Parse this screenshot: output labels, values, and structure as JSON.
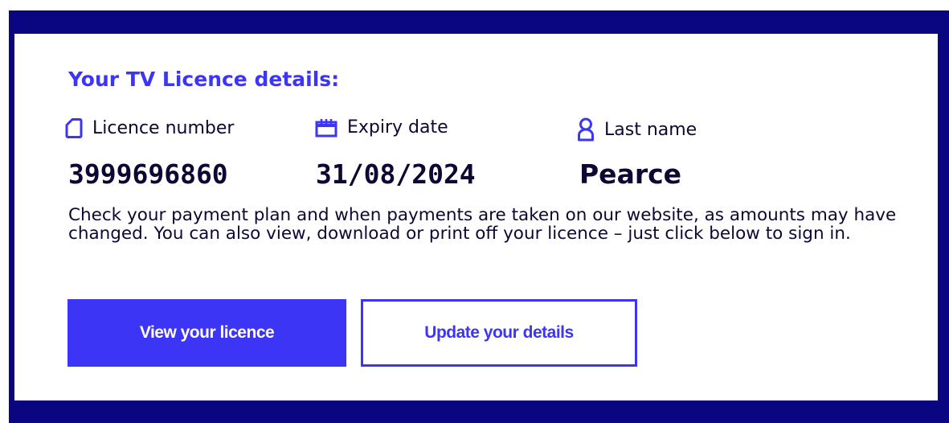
{
  "details": {
    "heading": "Your TV Licence details:",
    "fields": [
      {
        "label": "Licence number",
        "value": "3999696860",
        "icon": "licence-card-icon"
      },
      {
        "label": "Expiry date",
        "value": "31/08/2024",
        "icon": "calendar-icon"
      },
      {
        "label": "Last name",
        "value": "Pearce",
        "icon": "person-icon"
      }
    ],
    "notice": "Check your payment plan and when payments are taken on our website, as amounts may have changed. You can also view, download or print off your licence – just click below to sign in."
  },
  "actions": {
    "view_label": "View your licence",
    "update_label": "Update your details"
  },
  "colors": {
    "frame": "#0a0580",
    "accent": "#3d35f5",
    "text": "#0b0833",
    "card": "#ffffff"
  }
}
